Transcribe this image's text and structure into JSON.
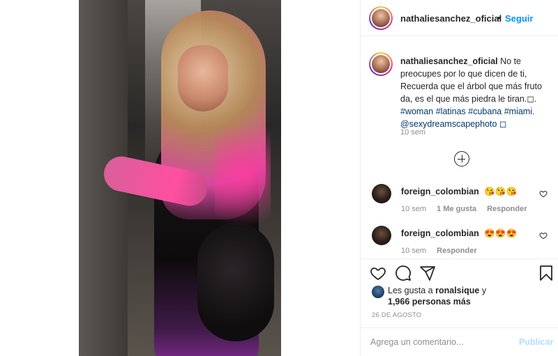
{
  "header": {
    "username": "nathaliesanchez_oficial",
    "separator": "•",
    "follow_label": "Seguir"
  },
  "caption": {
    "username": "nathaliesanchez_oficial",
    "text": "No te preocupes por lo que dicen de ti, Recuerda que el árbol que más fruto da, es el que más piedra le tiran.◻.",
    "hashtags": "#woman #latinas #cubana #miami.",
    "mention": "@sexydreamscapephoto ◻",
    "time": "10 sem"
  },
  "comments": [
    {
      "username": "foreign_colombian",
      "text": "😘😘😘",
      "time": "10 sem",
      "likes": "1 Me gusta",
      "reply": "Responder"
    },
    {
      "username": "foreign_colombian",
      "text": "😍😍😍",
      "time": "10 sem",
      "reply": "Responder"
    }
  ],
  "likes": {
    "prefix": "Les gusta a",
    "user": "ronalsique",
    "suffix": "y",
    "count": "1,966 personas más"
  },
  "date": "26 DE AGOSTO",
  "add_comment": {
    "placeholder": "Agrega un comentario...",
    "publish_label": "Publicar"
  },
  "icons": {
    "like": "heart-icon",
    "comment": "comment-icon",
    "share": "share-icon",
    "save": "bookmark-icon",
    "load_more": "plus-circle-icon"
  },
  "colors": {
    "link_blue": "#0095f6",
    "hashtag_blue": "#00376b",
    "muted": "#8e8e8e",
    "text": "#262626",
    "publish_disabled": "#b2dffc"
  }
}
